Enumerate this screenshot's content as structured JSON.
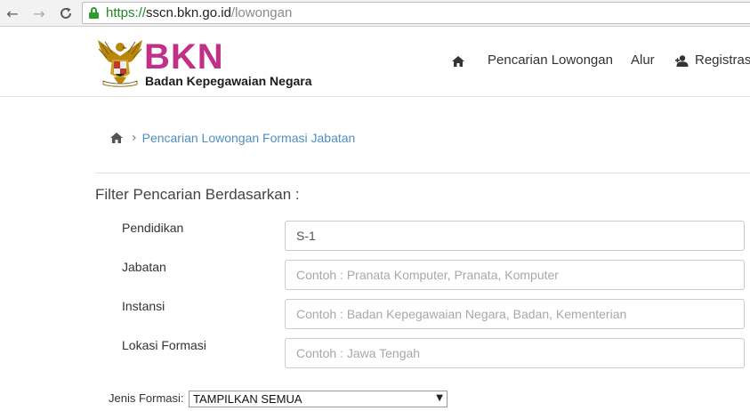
{
  "browser": {
    "url_scheme": "https://",
    "url_host": "sscn.bkn.go.id",
    "url_path": "/lowongan",
    "back_glyph": "←",
    "forward_glyph": "→",
    "reload_glyph": "C"
  },
  "header": {
    "brand": "BKN",
    "brand_subtitle": "Badan Kepegawaian Negara",
    "nav": {
      "search_label": "Pencarian Lowongan",
      "alur_label": "Alur",
      "register_label": "Registras"
    }
  },
  "breadcrumb": {
    "separator": "›",
    "current": "Pencarian Lowongan Formasi Jabatan"
  },
  "filter": {
    "title": "Filter Pencarian Berdasarkan :",
    "pendidikan": {
      "label": "Pendidikan",
      "value": "S-1",
      "placeholder": ""
    },
    "jabatan": {
      "label": "Jabatan",
      "value": "",
      "placeholder": "Contoh : Pranata Komputer, Pranata, Komputer"
    },
    "instansi": {
      "label": "Instansi",
      "value": "",
      "placeholder": "Contoh : Badan Kepegawaian Negara, Badan, Kementerian"
    },
    "lokasi": {
      "label": "Lokasi Formasi",
      "value": "",
      "placeholder": "Contoh : Jawa Tengah"
    },
    "jenis": {
      "label": "Jenis Formasi:",
      "selected": "TAMPILKAN SEMUA",
      "arrow": "▼"
    }
  },
  "colors": {
    "brand": "#c12f87",
    "link": "#4f8fc0",
    "secure": "#1e8a1e"
  },
  "icons": {
    "home": "home-icon",
    "register": "user-plus-icon",
    "lock": "lock-icon",
    "emblem": "garuda-emblem"
  }
}
